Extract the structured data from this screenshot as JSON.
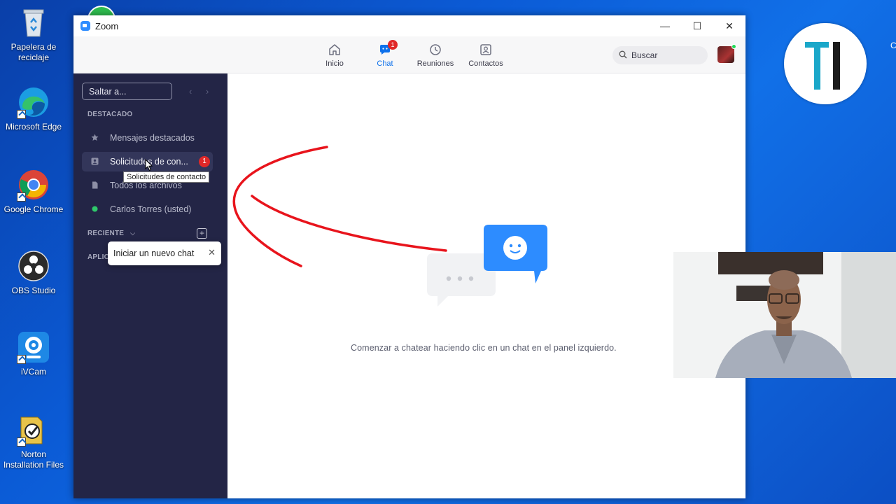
{
  "desktop": {
    "icons": [
      {
        "label": "Papelera de reciclaje",
        "icon": "recycle-bin-icon"
      },
      {
        "label": "Microsoft Edge",
        "icon": "edge-icon"
      },
      {
        "label": "Google Chrome",
        "icon": "chrome-icon"
      },
      {
        "label": "OBS Studio",
        "icon": "obs-icon"
      },
      {
        "label": "iVCam",
        "icon": "ivcam-icon"
      },
      {
        "label": "Norton Installation Files",
        "icon": "norton-icon"
      }
    ],
    "edge_text": "C"
  },
  "window": {
    "title": "Zoom",
    "controls": {
      "minimize": "—",
      "maximize": "☐",
      "close": "✕"
    }
  },
  "toolbar": {
    "tabs": [
      {
        "label": "Inicio",
        "icon": "home-icon",
        "active": false
      },
      {
        "label": "Chat",
        "icon": "chat-icon",
        "active": true,
        "badge": "1"
      },
      {
        "label": "Reuniones",
        "icon": "clock-icon",
        "active": false
      },
      {
        "label": "Contactos",
        "icon": "contacts-icon",
        "active": false
      }
    ],
    "search": {
      "placeholder": "Buscar"
    },
    "accent": "#0e71eb"
  },
  "sidebar": {
    "jump_placeholder": "Saltar a...",
    "starred_header": "DESTACADO",
    "items": [
      {
        "label": "Mensajes destacados",
        "icon": "star-icon"
      },
      {
        "label": "Solicitudes de con...",
        "icon": "contact-request-icon",
        "badge": "1"
      },
      {
        "label": "Todos los archivos",
        "icon": "file-icon"
      },
      {
        "label": "Carlos Torres (usted)",
        "icon": "online-dot-icon"
      }
    ],
    "recent_header": "RECIENTE",
    "apps_header": "APLICA",
    "tooltip": "Solicitudes de contacto",
    "new_chat_popup": "Iniciar un nuevo chat"
  },
  "main": {
    "empty_message": "Comenzar a chatear haciendo clic en un chat en el panel izquierdo."
  },
  "overlay": {
    "logo_text": "TI"
  },
  "colors": {
    "sidebar_bg": "#232546",
    "badge_red": "#e02828",
    "annotation_red": "#e8141c",
    "bubble_blue": "#2d8cff"
  }
}
